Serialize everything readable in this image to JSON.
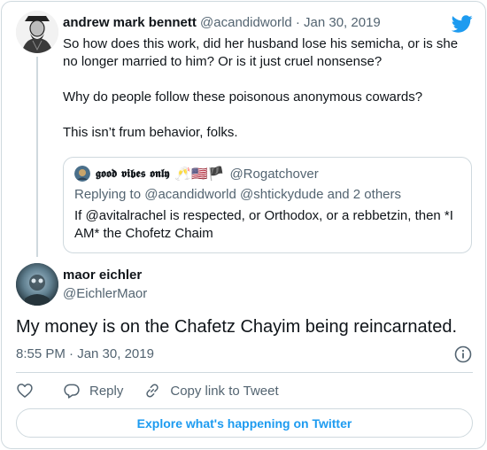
{
  "parent_tweet": {
    "display_name": "andrew mark bennett",
    "handle": "@acandidworld",
    "date": "Jan 30, 2019",
    "paragraphs": [
      "So how does this work, did her husband lose his semicha, or is she no longer married to him? Or is it just cruel nonsense?",
      "Why do people follow these poisonous anonymous cowards?",
      "This isn’t frum behavior, folks."
    ]
  },
  "quoted_tweet": {
    "display_name": "𝖌𝖔𝖔𝖉 𝖛𝖎𝖇𝖊𝖘 𝖔𝖓𝖑𝖞",
    "emoji": "🥂🇺🇸🏴",
    "handle": "@Rogatchover",
    "reply_context": "Replying to @acandidworld @shtickydude and 2 others",
    "text": "If @avitalrachel is respected, or Orthodox, or a rebbetzin, then *I AM* the Chofetz Chaim"
  },
  "main_tweet": {
    "display_name": "maor eichler",
    "handle": "@EichlerMaor",
    "text": "My money is on the Chafetz Chayim being reincarnated.",
    "timestamp": "8:55 PM · Jan 30, 2019"
  },
  "actions": {
    "reply_label": "Reply",
    "copy_link_label": "Copy link to Tweet"
  },
  "explore_label": "Explore what's happening on Twitter",
  "colors": {
    "brand_blue": "#1d9bf0",
    "text": "#0f1419",
    "secondary": "#536471",
    "border": "#cfd9de"
  },
  "icons": [
    "twitter-bird-icon",
    "info-icon",
    "heart-icon",
    "reply-icon",
    "link-icon"
  ]
}
